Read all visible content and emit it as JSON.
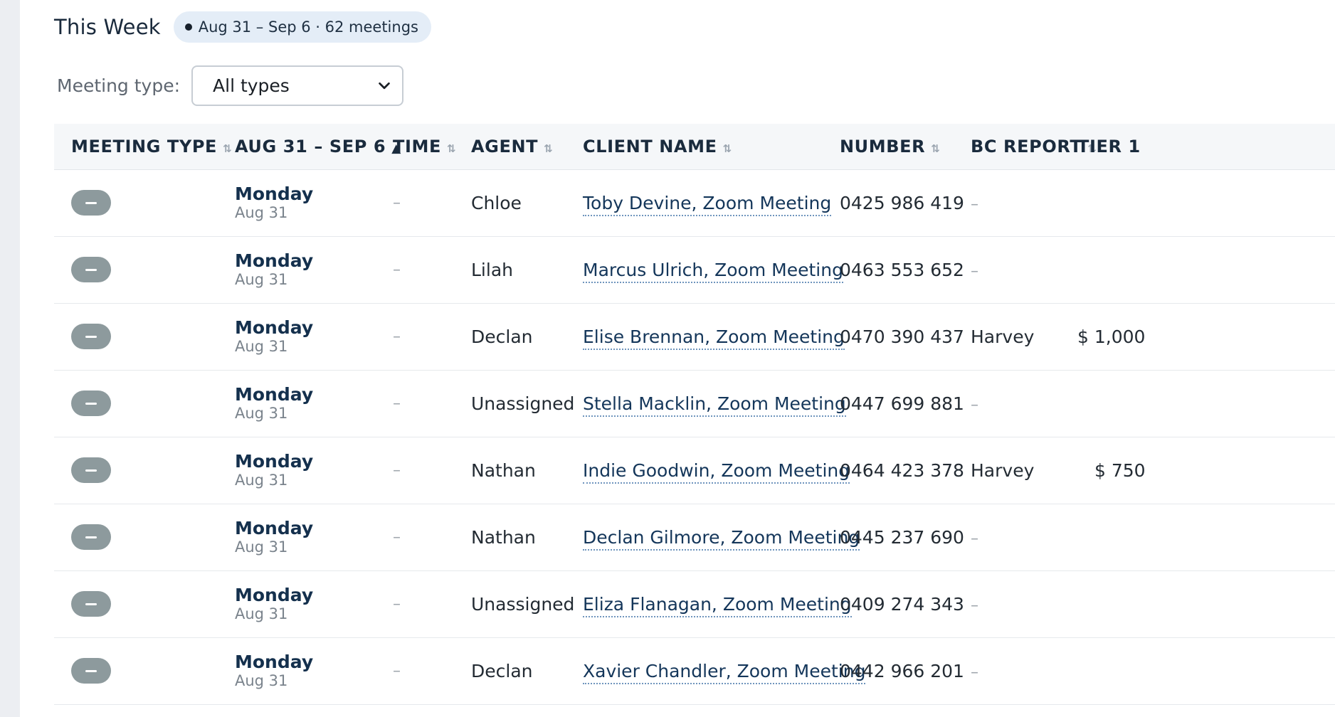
{
  "header": {
    "title": "This Week",
    "badge": "Aug 31 – Sep 6 · 62 meetings"
  },
  "filter": {
    "label": "Meeting type:",
    "selected": "All types"
  },
  "table": {
    "columns": [
      {
        "label": "MEETING TYPE",
        "sort": "⇅"
      },
      {
        "label": "AUG 31 – SEP 6",
        "sort": "▲"
      },
      {
        "label": "TIME",
        "sort": "⇅"
      },
      {
        "label": "AGENT",
        "sort": "⇅"
      },
      {
        "label": "CLIENT NAME",
        "sort": "⇅"
      },
      {
        "label": "NUMBER",
        "sort": "⇅"
      },
      {
        "label": "BC REPORT",
        "sort": "⇅"
      },
      {
        "label": "TIER 1",
        "sort": ""
      }
    ],
    "rows": [
      {
        "day": "Monday",
        "date": "Aug 31",
        "time": "–",
        "agent": "Chloe",
        "client": "Toby Devine, Zoom Meeting",
        "number": "0425 986 419",
        "bc": "–",
        "tier": ""
      },
      {
        "day": "Monday",
        "date": "Aug 31",
        "time": "–",
        "agent": "Lilah",
        "client": "Marcus Ulrich, Zoom Meeting",
        "number": "0463 553 652",
        "bc": "–",
        "tier": ""
      },
      {
        "day": "Monday",
        "date": "Aug 31",
        "time": "–",
        "agent": "Declan",
        "client": "Elise Brennan, Zoom Meeting",
        "number": "0470 390 437",
        "bc": "Harvey",
        "tier": "$ 1,000"
      },
      {
        "day": "Monday",
        "date": "Aug 31",
        "time": "–",
        "agent": "Unassigned",
        "client": "Stella Macklin, Zoom Meeting",
        "number": "0447 699 881",
        "bc": "–",
        "tier": ""
      },
      {
        "day": "Monday",
        "date": "Aug 31",
        "time": "–",
        "agent": "Nathan",
        "client": "Indie Goodwin, Zoom Meeting",
        "number": "0464 423 378",
        "bc": "Harvey",
        "tier": "$ 750"
      },
      {
        "day": "Monday",
        "date": "Aug 31",
        "time": "–",
        "agent": "Nathan",
        "client": "Declan Gilmore, Zoom Meeting",
        "number": "0445 237 690",
        "bc": "–",
        "tier": ""
      },
      {
        "day": "Monday",
        "date": "Aug 31",
        "time": "–",
        "agent": "Unassigned",
        "client": "Eliza Flanagan, Zoom Meeting",
        "number": "0409 274 343",
        "bc": "–",
        "tier": ""
      },
      {
        "day": "Monday",
        "date": "Aug 31",
        "time": "–",
        "agent": "Declan",
        "client": "Xavier Chandler, Zoom Meeting",
        "number": "0442 966 201",
        "bc": "–",
        "tier": ""
      }
    ]
  }
}
